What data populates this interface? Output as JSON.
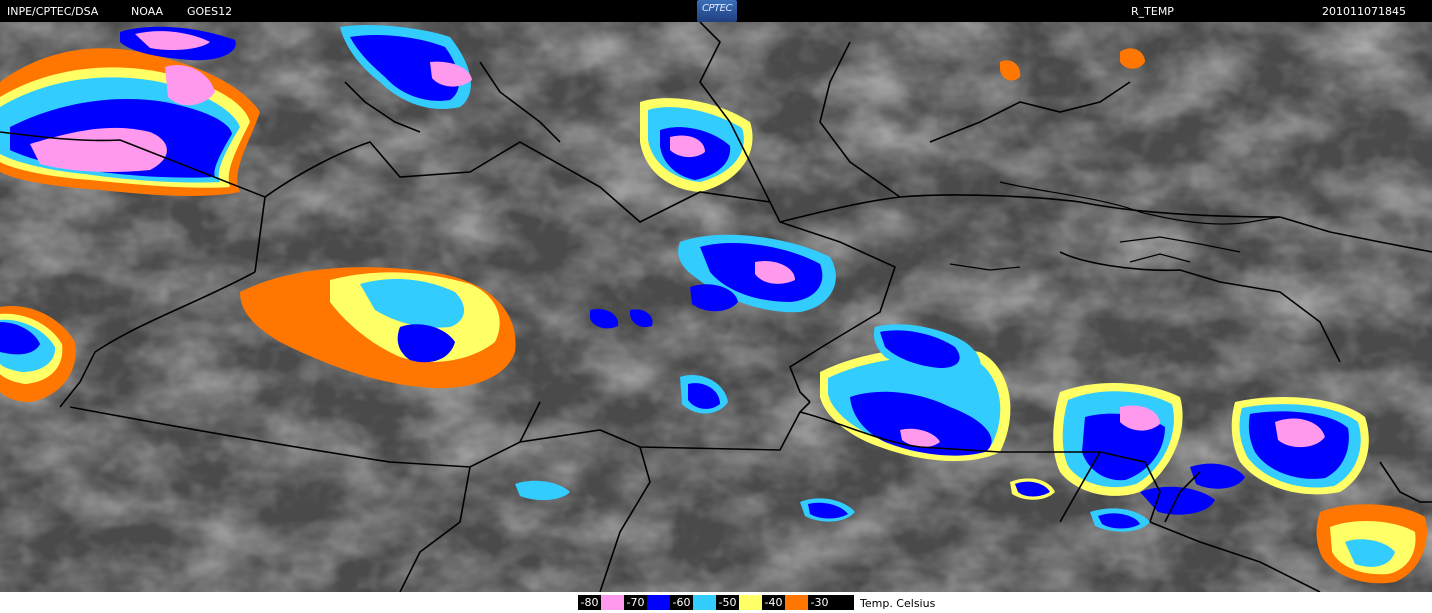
{
  "header": {
    "source": "INPE/CPTEC/DSA",
    "agency": "NOAA",
    "satellite": "GOES12",
    "logo_text": "CPTEC",
    "product": "R_TEMP",
    "timestamp": "201011071845"
  },
  "legend": {
    "items": [
      {
        "label": "-80",
        "color": "#ff99ee"
      },
      {
        "label": "-70",
        "color": "#0000ff"
      },
      {
        "label": "-60",
        "color": "#33ccff"
      },
      {
        "label": "-50",
        "color": "#ffff66"
      },
      {
        "label": "-40",
        "color": "#ff7700"
      },
      {
        "label": "-30",
        "color": "#000000"
      }
    ],
    "unit": "Temp. Celsius"
  }
}
